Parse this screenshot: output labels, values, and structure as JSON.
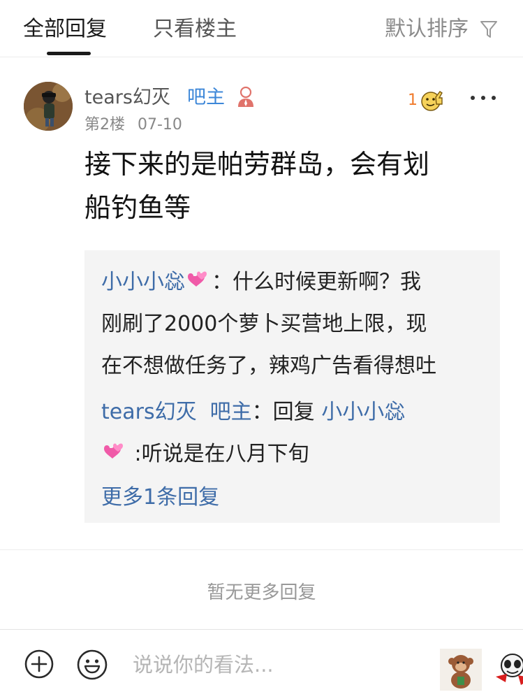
{
  "tabs": {
    "all_replies": "全部回复",
    "only_op": "只看楼主",
    "sort_label": "默认排序"
  },
  "post": {
    "username": "tears幻灭",
    "badge": "吧主",
    "floor": "第2楼",
    "date": "07-10",
    "like_count": "1",
    "text_line1": "接下来的是帕劳群岛，会有划",
    "text_line2": "船钓鱼等"
  },
  "replies": {
    "reply1_name": "小小小惢",
    "reply1_sep": "：",
    "reply1_line1": "什么时候更新啊？我",
    "reply1_line2": "刚刷了2000个萝卜买营地上限，现",
    "reply1_line3": "在不想做任务了，辣鸡广告看得想吐",
    "reply2_name": "tears幻灭",
    "reply2_badge": "吧主",
    "reply2_sep": "：",
    "reply2_verb": "回复",
    "reply2_target": "小小小惢",
    "reply2_text": ":听说是在八月下旬",
    "more_replies": "更多1条回复"
  },
  "no_more_replies": "暂无更多回复",
  "bottom": {
    "input_placeholder": "说说你的看法..."
  },
  "colors": {
    "link_blue": "#3e6ca8",
    "badge_blue": "#3d87d8",
    "like_orange": "#f07a2b",
    "reply_bg": "#f4f4f4"
  },
  "icons": [
    "filter-icon",
    "admin-icon",
    "thumb-up-sticker-icon",
    "more-icon",
    "heart-emoji-icon",
    "add-icon",
    "emoji-icon",
    "monkey-sticker-icon",
    "panda-sticker-icon"
  ]
}
